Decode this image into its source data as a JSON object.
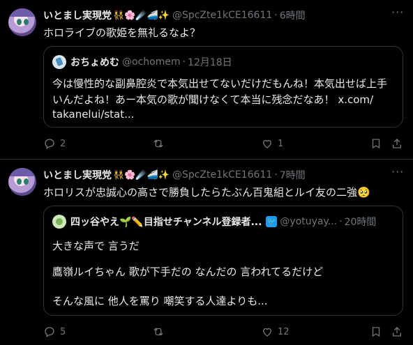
{
  "posts": [
    {
      "author": "いとまし実現党",
      "emojis": "👯🌸☄️🚄✨",
      "handle": "@SpcZte1kCE16611",
      "time": "6時間",
      "more": "···",
      "text": "ホロライブの歌姫を無礼るなよ？",
      "quote": {
        "name": "おちょめむ",
        "handle": "@ochomem",
        "time": "12月18日",
        "lines": [
          "今は慢性的な副鼻腔炎で本気出せてないだけだもんね！本気出せば上手",
          "いんだよね！あー本気の歌が聞けなくて本当に残念だなあ！ x.com/",
          "takanelui/stat..."
        ]
      },
      "actions": {
        "reply": "2",
        "repost": "",
        "like": "1",
        "views": ""
      }
    },
    {
      "author": "いとまし実現党",
      "emojis": "👯🌸☄️🚄✨",
      "handle": "@SpcZte1kCE16611",
      "time": "7時間",
      "more": "···",
      "text": "ホロリスが忠誠心の高さで勝負したらたぶん百鬼組とルイ友の二強🥺",
      "quote": {
        "name": "四ッ谷やえ🌱✏️目指せチャンネル登録者...",
        "badge": "🐦",
        "handle": "@yotuyay...",
        "time": "20時間",
        "lines": [
          "大きな声で 言うだ",
          "鷹嶺ルイちゃん 歌が下手だの なんだの 言われてるだけど",
          "そんな風に 他人を罵り 嘲笑する人達よりも..."
        ]
      },
      "actions": {
        "reply": "5",
        "repost": "",
        "like": "12",
        "views": ""
      }
    }
  ],
  "colors": {
    "background": "#000000",
    "text": "#e7e9ea",
    "muted": "#71767b",
    "border": "#2f3336",
    "accent": "#1d9bf0"
  },
  "icons": [
    "reply-icon",
    "repost-icon",
    "like-icon",
    "bookmark-icon",
    "share-icon"
  ]
}
